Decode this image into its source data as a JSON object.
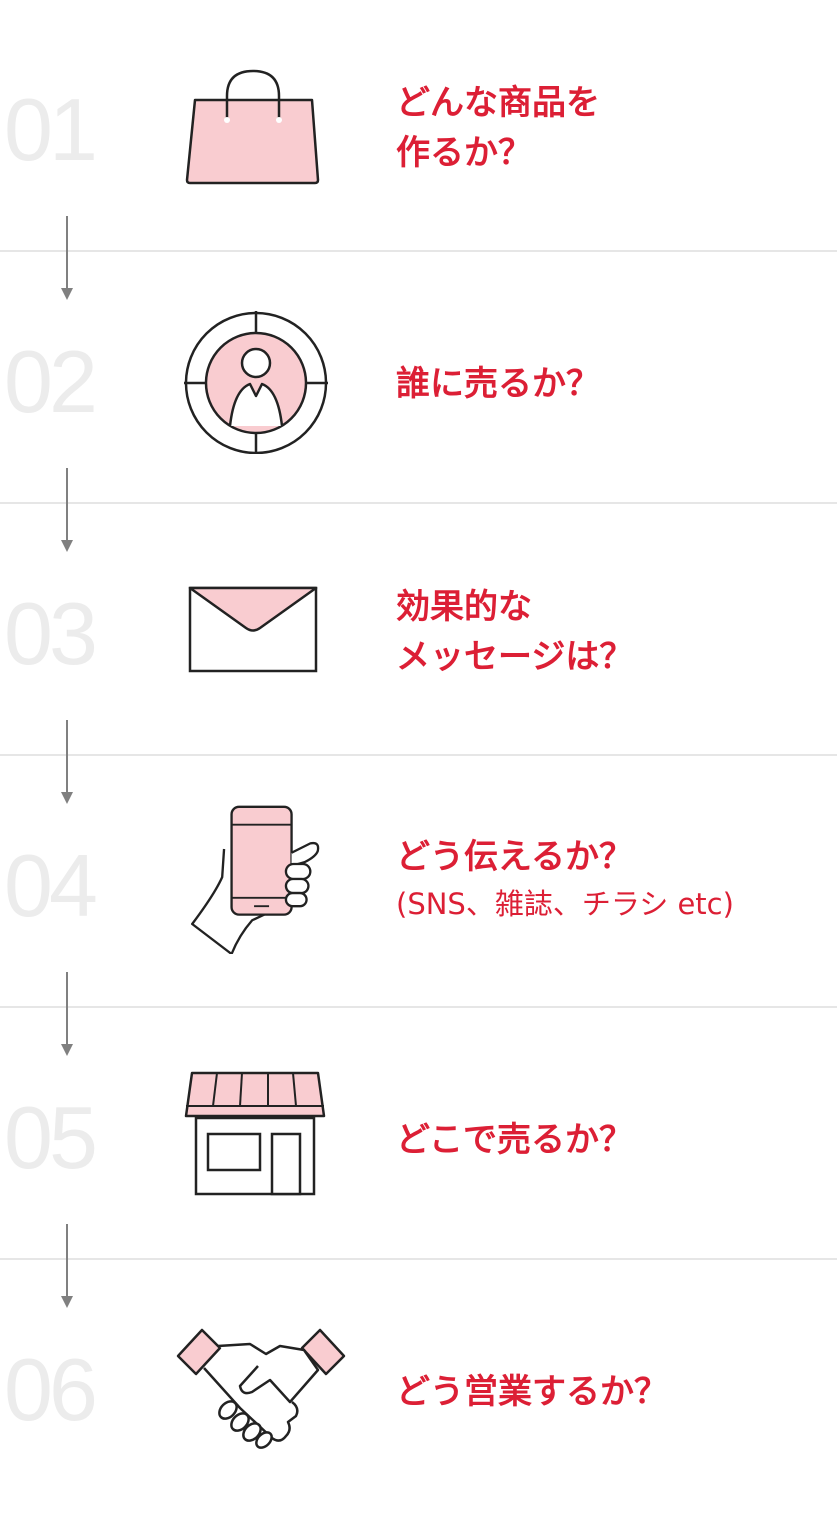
{
  "steps": [
    {
      "number": "01",
      "icon": "shopping-bag-icon",
      "lines": [
        "どんな商品を",
        "作るか？"
      ],
      "sub": ""
    },
    {
      "number": "02",
      "icon": "target-person-icon",
      "lines": [
        "誰に売るか？"
      ],
      "sub": ""
    },
    {
      "number": "03",
      "icon": "envelope-icon",
      "lines": [
        "効果的な",
        "メッセージは？"
      ],
      "sub": ""
    },
    {
      "number": "04",
      "icon": "smartphone-hand-icon",
      "lines": [
        "どう伝えるか？"
      ],
      "sub": "(SNS、雑誌、チラシ etc)"
    },
    {
      "number": "05",
      "icon": "storefront-icon",
      "lines": [
        "どこで売るか？"
      ],
      "sub": ""
    },
    {
      "number": "06",
      "icon": "handshake-icon",
      "lines": [
        "どう営業するか？"
      ],
      "sub": ""
    }
  ],
  "colors": {
    "accent": "#dc1f35",
    "icon_fill": "#f9ccd0",
    "number": "#ececec",
    "divider": "#e6e6e6",
    "arrow": "#808080"
  }
}
